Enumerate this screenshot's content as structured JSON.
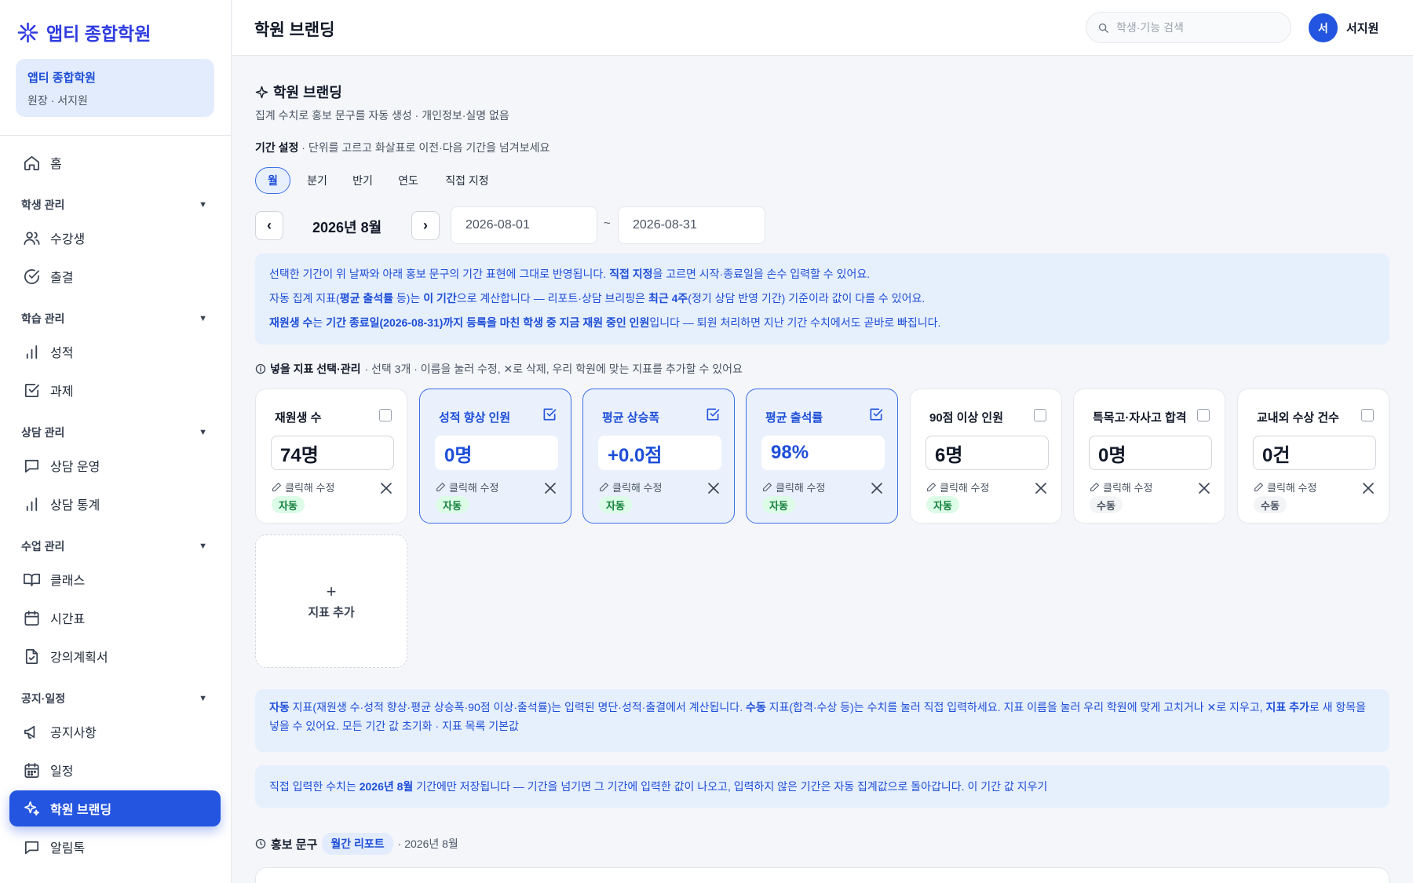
{
  "sidebar": {
    "logo": "앱티 종합학원",
    "academy_name": "앱티 종합학원",
    "academy_role": "원장 · 서지원",
    "items": [
      {
        "label": "홈",
        "icon": "home-icon"
      },
      {
        "section": "학생 관리"
      },
      {
        "label": "수강생",
        "icon": "users-icon"
      },
      {
        "label": "출결",
        "icon": "check-circle-icon"
      },
      {
        "section": "학습 관리"
      },
      {
        "label": "성적",
        "icon": "bar-chart-icon"
      },
      {
        "label": "과제",
        "icon": "check-square-icon"
      },
      {
        "section": "상담 관리"
      },
      {
        "label": "상담 운영",
        "icon": "message-icon"
      },
      {
        "label": "상담 통계",
        "icon": "bar-chart-icon"
      },
      {
        "section": "수업 관리"
      },
      {
        "label": "클래스",
        "icon": "book-icon"
      },
      {
        "label": "시간표",
        "icon": "calendar-icon"
      },
      {
        "label": "강의계획서",
        "icon": "file-check-icon"
      },
      {
        "section": "공지·일정"
      },
      {
        "label": "공지사항",
        "icon": "megaphone-icon"
      },
      {
        "label": "일정",
        "icon": "calendar-grid-icon"
      },
      {
        "label": "학원 브랜딩",
        "icon": "sparkle-icon",
        "active": true
      },
      {
        "label": "알림톡",
        "icon": "message-icon"
      }
    ]
  },
  "header": {
    "title": "학원 브랜딩",
    "search_placeholder": "학생·기능 검색",
    "avatar_initial": "서",
    "user_name": "서지원"
  },
  "main": {
    "section_title": "학원 브랜딩",
    "section_subtitle": "집계 수치로 홍보 문구를 자동 생성 · 개인정보·실명 없음",
    "period_label": "기간 설정",
    "period_hint": " · 단위를 고르고 화살표로 이전·다음 기간을 넘겨보세요",
    "period_tabs": [
      "월",
      "분기",
      "반기",
      "연도",
      "직접 지정"
    ],
    "active_tab": "월",
    "prev": "‹",
    "next": "›",
    "current_period": "2026년 8월",
    "start_date": "2026-08-01",
    "end_date": "2026-08-31",
    "tilde": "~",
    "info": {
      "l1a": "선택한 기간이 위 날짜와 아래 홍보 문구의 기간 표현에 그대로 반영됩니다. ",
      "l1b": "직접 지정",
      "l1c": "을 고르면 시작·종료일을 손수 입력할 수 있어요.",
      "l2a": "자동 집계 지표(",
      "l2b": "평균 출석률",
      "l2c": " 등)는 ",
      "l2d": "이 기간",
      "l2e": "으로 계산합니다 — 리포트·상담 브리핑은 ",
      "l2f": "최근 4주",
      "l2g": "(정기 상담 반영 기간) 기준이라 값이 다를 수 있어요.",
      "l3a": "재원생 수",
      "l3b": "는 ",
      "l3c": "기간 종료일(2026-08-31)까지 등록을 마친 학생 중 지금 재원 중인 인원",
      "l3d": "입니다 — 퇴원 처리하면 지난 기간 수치에서도 곧바로 빠집니다."
    },
    "metric_head_label": "넣을 지표 선택·관리",
    "metric_head_hint": " · 선택 3개 · 이름을 눌러 수정, ✕로 삭제, 우리 학원에 맞는 지표를 추가할 수 있어요",
    "edit_hint": "클릭해 수정",
    "metrics": [
      {
        "name": "재원생 수",
        "value": "74명",
        "tag": "자동",
        "selected": false
      },
      {
        "name": "성적 향상 인원",
        "value": "0명",
        "tag": "자동",
        "selected": true
      },
      {
        "name": "평균 상승폭",
        "value": "+0.0점",
        "tag": "자동",
        "selected": true
      },
      {
        "name": "평균 출석률",
        "value": "98%",
        "tag": "자동",
        "selected": true
      },
      {
        "name": "90점 이상 인원",
        "value": "6명",
        "tag": "자동",
        "selected": false
      },
      {
        "name": "특목고·자사고 합격",
        "value": "0명",
        "tag": "수동",
        "selected": false
      },
      {
        "name": "교내외 수상 건수",
        "value": "0건",
        "tag": "수동",
        "selected": false
      }
    ],
    "add_metric_plus": "+",
    "add_metric_label": "지표 추가",
    "note1": {
      "a": "자동",
      "b": " 지표(재원생 수·성적 향상·평균 상승폭·90점 이상·출석률)는 입력된 명단·성적·출결에서 계산됩니다. ",
      "c": "수동",
      "d": " 지표(합격·수상 등)는 수치를 눌러 직접 입력하세요. 지표 이름을 눌러 우리 학원에 맞게 고치거나 ✕로 지우고, ",
      "e": "지표 추가",
      "f": "로 새 항목을 넣을 수 있어요. 모든 기간 값 초기화 · 지표 목록 기본값"
    },
    "note2": {
      "a": "직접 입력한 수치는 ",
      "b": "2026년 8월",
      "c": " 기간에만 저장됩니다 — 기간을 넘기면 그 기간에 입력한 값이 나오고, 입력하지 않은 기간은 자동 집계값으로 돌아갑니다. 이 기간 값 지우기"
    },
    "promo_label": "홍보 문구",
    "promo_tab": "월간 리포트",
    "promo_period": "· 2026년 8월"
  },
  "colors": {
    "accent": "#2455e0",
    "info_bg": "#e6effc",
    "auto_tag": "#dcfce7",
    "manual_tag": "#f3f4f6"
  }
}
